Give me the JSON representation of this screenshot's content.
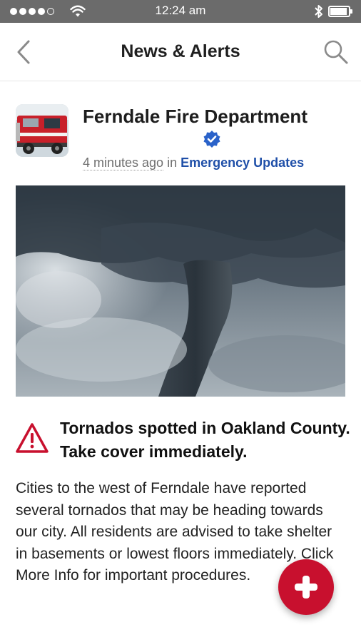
{
  "status_bar": {
    "time": "12:24 am",
    "signal_bars_filled": 4,
    "signal_bars_total": 5,
    "battery_level": 0.9,
    "icons": [
      "signal-dots-icon",
      "wifi-icon",
      "bluetooth-icon",
      "battery-icon"
    ]
  },
  "nav": {
    "title": "News & Alerts",
    "back_icon": "chevron-left-icon",
    "search_icon": "search-icon"
  },
  "post": {
    "source_name": "Ferndale Fire Department",
    "verified_icon": "verified-badge-icon",
    "time_ago": "4 minutes ago",
    "in_label": "in",
    "category": "Emergency Updates",
    "alert_icon": "warning-triangle-icon",
    "headline": "Tornados spotted in Oakland County. Take cover immediately.",
    "body": "Cities to the west of Ferndale have reported several tornados that may be heading towards our city.  All residents are advised to take shelter in basements or lowest floors immediately.  Click More Info for important procedures."
  },
  "fab": {
    "icon": "plus-icon"
  },
  "colors": {
    "status_bar_bg": "#6b6b6b",
    "accent_red": "#c8102e",
    "category_blue": "#1f4fa8",
    "verified_blue": "#2a62c9"
  }
}
